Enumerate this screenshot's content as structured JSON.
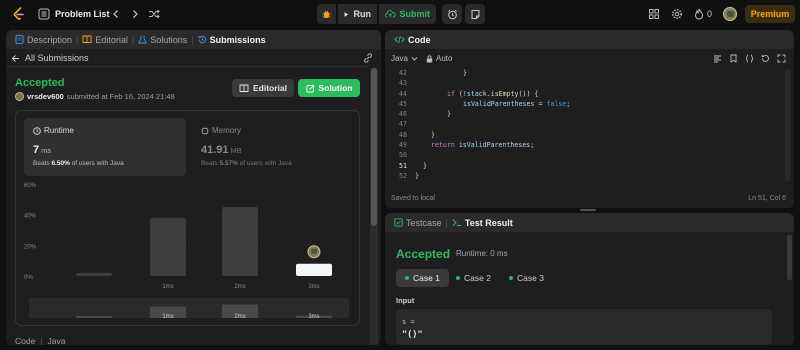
{
  "topbar": {
    "title": "Problem List",
    "run_label": "Run",
    "submit_label": "Submit",
    "streak_count": "0",
    "premium_label": "Premium"
  },
  "left_tabs": [
    "Description",
    "Editorial",
    "Solutions",
    "Submissions"
  ],
  "submission": {
    "back_label": "All Submissions",
    "status": "Accepted",
    "username": "vrsdev600",
    "submitted_text": "submitted at Feb 16, 2024 21:48",
    "editorial_button": "Editorial",
    "solution_button": "Solution"
  },
  "runtime": {
    "label": "Runtime",
    "value": "7",
    "unit": "ms",
    "beats_prefix": "Beats",
    "beats_pct": "6.50%",
    "beats_suffix": "of users with Java"
  },
  "memory": {
    "label": "Memory",
    "value": "41.91",
    "unit": "MB",
    "beats_prefix": "Beats",
    "beats_pct": "5.57%",
    "beats_suffix": "of users with Java"
  },
  "chart_data": {
    "type": "bar",
    "y_ticks": [
      "60%",
      "40%",
      "20%",
      "0%"
    ],
    "ylim": [
      0,
      60
    ],
    "categories": [
      "",
      "1ms",
      "2ms",
      "3ms"
    ],
    "values": [
      2,
      38,
      45,
      8
    ],
    "highlight_index": 3,
    "mini_labels": [
      "1ms",
      "2ms",
      "3ms"
    ]
  },
  "footer": {
    "code_label": "Code",
    "lang_label": "Java"
  },
  "code_panel": {
    "title": "Code",
    "language": "Java",
    "autosave": "Auto",
    "saved_text": "Saved to local",
    "cursor_pos": "Ln 51, Col 6",
    "current_line": "51",
    "lines": [
      {
        "n": "42",
        "indent": 12,
        "tokens": [
          {
            "t": "}",
            "c": "plain"
          }
        ]
      },
      {
        "n": "43",
        "indent": 0,
        "tokens": []
      },
      {
        "n": "44",
        "indent": 8,
        "tokens": [
          {
            "t": "if",
            "c": "kw"
          },
          {
            "t": " (!",
            "c": "plain"
          },
          {
            "t": "stack",
            "c": "var"
          },
          {
            "t": ".",
            "c": "plain"
          },
          {
            "t": "isEmpty",
            "c": "fn"
          },
          {
            "t": "()) {",
            "c": "plain"
          }
        ]
      },
      {
        "n": "45",
        "indent": 12,
        "tokens": [
          {
            "t": "isValidParentheses",
            "c": "var"
          },
          {
            "t": " = ",
            "c": "plain"
          },
          {
            "t": "false",
            "c": "bool"
          },
          {
            "t": ";",
            "c": "plain"
          }
        ]
      },
      {
        "n": "46",
        "indent": 8,
        "tokens": [
          {
            "t": "}",
            "c": "plain"
          }
        ]
      },
      {
        "n": "47",
        "indent": 0,
        "tokens": []
      },
      {
        "n": "48",
        "indent": 4,
        "tokens": [
          {
            "t": "}",
            "c": "plain"
          }
        ]
      },
      {
        "n": "49",
        "indent": 4,
        "tokens": [
          {
            "t": "return",
            "c": "kw"
          },
          {
            "t": " ",
            "c": "plain"
          },
          {
            "t": "isValidParentheses",
            "c": "var"
          },
          {
            "t": ";",
            "c": "plain"
          }
        ]
      },
      {
        "n": "50",
        "indent": 0,
        "tokens": []
      },
      {
        "n": "51",
        "indent": 2,
        "tokens": [
          {
            "t": "}",
            "c": "plain"
          }
        ]
      },
      {
        "n": "52",
        "indent": 0,
        "tokens": [
          {
            "t": "}",
            "c": "plain"
          }
        ]
      }
    ]
  },
  "test_panel": {
    "tab_testcase": "Testcase",
    "tab_result": "Test Result",
    "status": "Accepted",
    "runtime_text": "Runtime: 0 ms",
    "cases": [
      "Case 1",
      "Case 2",
      "Case 3"
    ],
    "input_label": "Input",
    "input_var": "s =",
    "input_value": "\"()\""
  },
  "colors": {
    "accent_green": "#2cbb5d",
    "premium_orange": "#ffa116",
    "bg": "#101010",
    "panel": "#1e1e1e"
  }
}
